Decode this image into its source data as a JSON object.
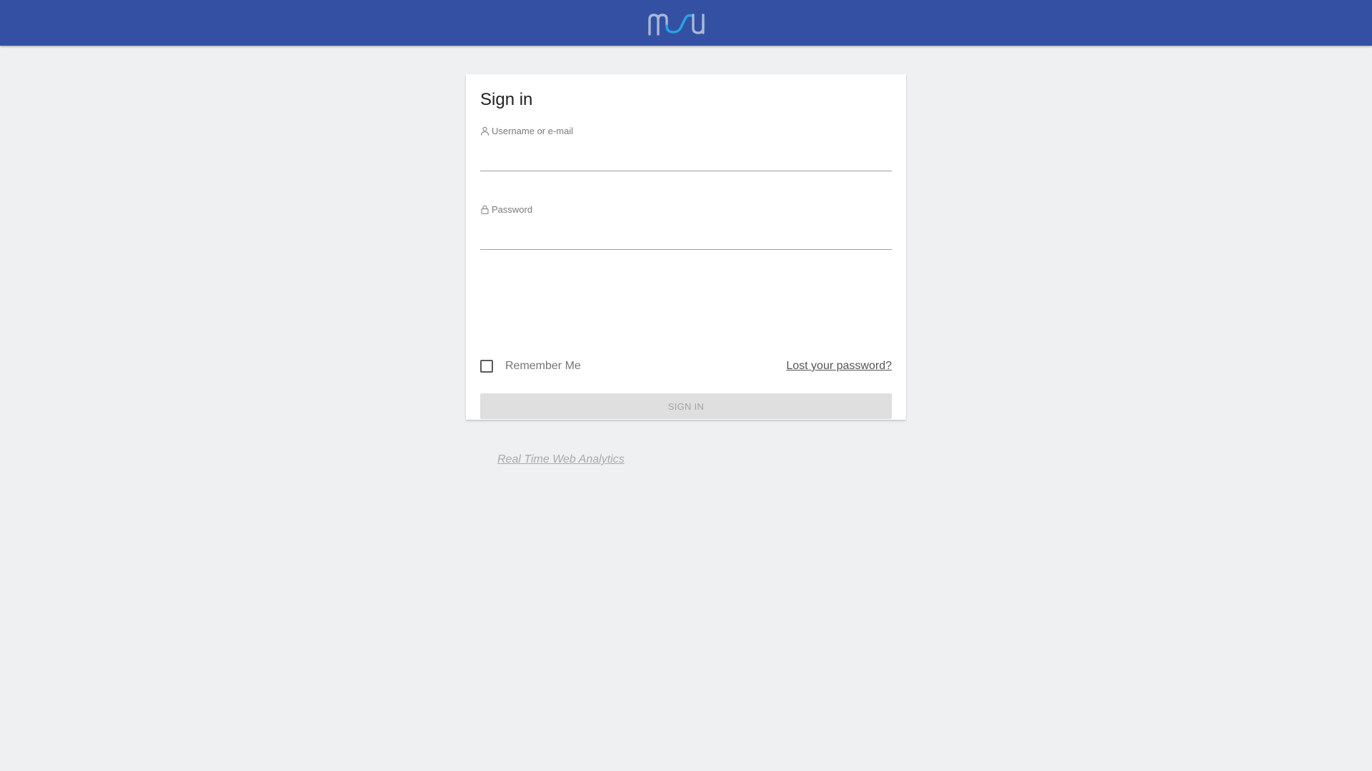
{
  "header": {
    "logo_icon": "matomo-logo",
    "colors": {
      "bar": "#3450a3",
      "logo_gray": "#a9b6d6",
      "logo_blue": "#26a5e6"
    }
  },
  "card": {
    "title": "Sign in",
    "username": {
      "label": "Username or e-mail",
      "icon": "user-icon",
      "value": "",
      "placeholder": ""
    },
    "password": {
      "label": "Password",
      "icon": "lock-icon",
      "value": "",
      "placeholder": ""
    },
    "remember_me": {
      "label": "Remember Me",
      "checked": false
    },
    "lost_password": "Lost your password?",
    "submit_label": "SIGN IN",
    "footer_link": "Real Time Web Analytics"
  }
}
